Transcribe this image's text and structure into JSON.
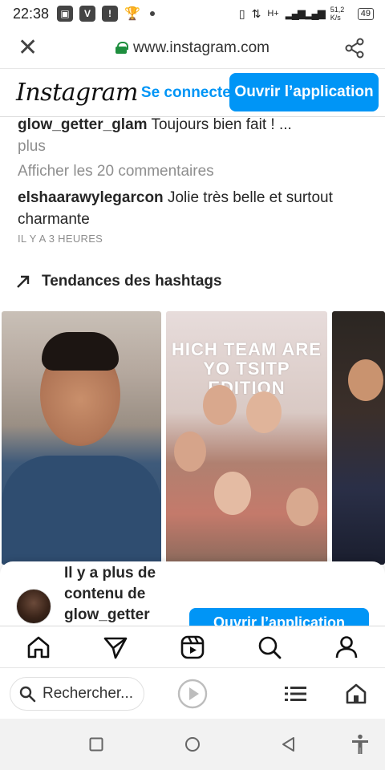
{
  "status_bar": {
    "time": "22:38",
    "network_speed": "51,2 K/s",
    "battery": "49",
    "network_type": "H+"
  },
  "browser": {
    "url": "www.instagram.com"
  },
  "ig_header": {
    "logo_text": "Instagram",
    "login_label": "Se connecter",
    "open_app_label": "Ouvrir l’application"
  },
  "comments": {
    "first": {
      "user": "glow_getter_glam",
      "text": "Toujours bien fait ! ...",
      "more": "plus"
    },
    "view_all": "Afficher les 20 commentaires",
    "second": {
      "user": "elshaarawylegarcon",
      "text": "Jolie très belle et surtout charmante"
    },
    "time_ago": "IL Y A 3 HEURES"
  },
  "trending": {
    "title": "Tendances des hashtags",
    "thumb2_text": "HICH TEAM ARE YO TSITP EDITION"
  },
  "sheet": {
    "text": "Il y a plus de contenu de glow_getter",
    "button_label": "Ouvrir l’application"
  },
  "browser_bar": {
    "search_placeholder": "Rechercher..."
  },
  "colors": {
    "ig_blue": "#0095f6",
    "lock_green": "#1e8e3e"
  }
}
